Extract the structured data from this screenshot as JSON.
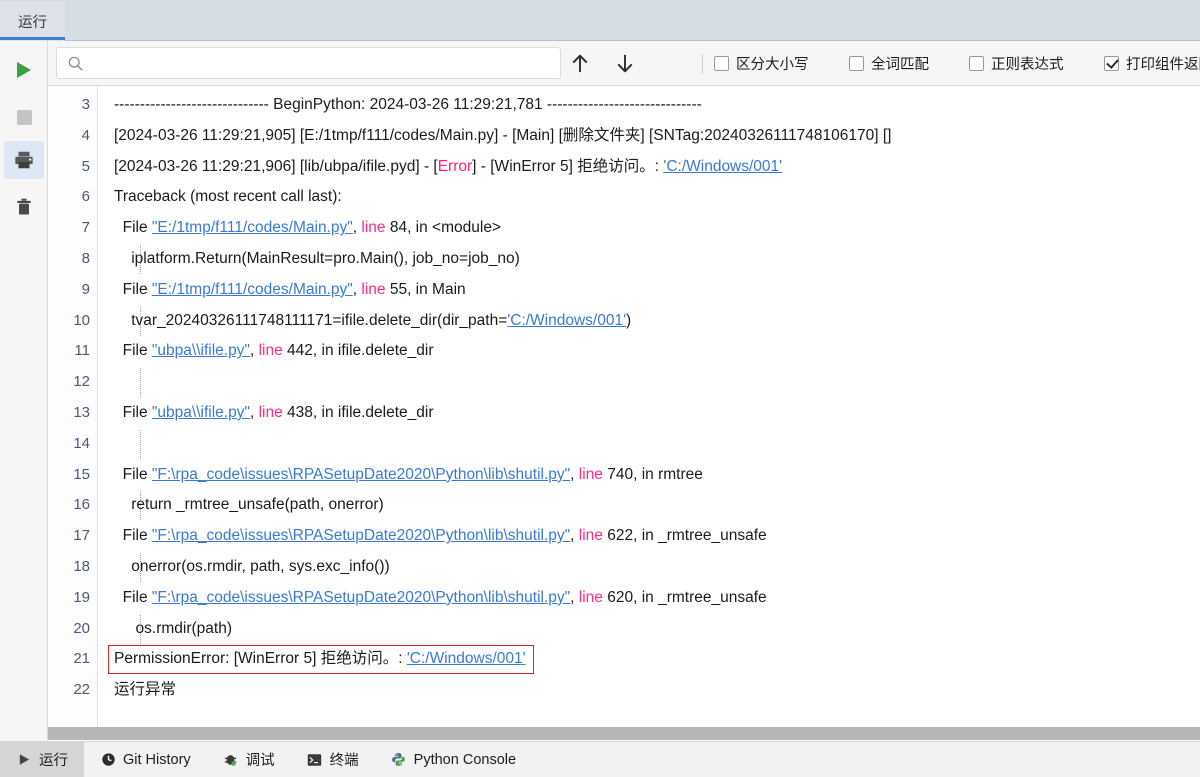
{
  "window": {
    "tab_label": "运行",
    "accent_color": "#3b7fd4"
  },
  "left_toolbar": {
    "buttons": [
      {
        "name": "run-button",
        "icon": "play-icon",
        "label": "运行",
        "active": false
      },
      {
        "name": "stop-button",
        "icon": "stop-icon",
        "label": "停止",
        "active": false
      },
      {
        "name": "print-button",
        "icon": "printer-icon",
        "label": "打印",
        "active": true
      },
      {
        "name": "clear-button",
        "icon": "trash-icon",
        "label": "清空",
        "active": false
      }
    ]
  },
  "findbar": {
    "search_value": "",
    "search_placeholder": "",
    "search_icon": "search-icon",
    "prev_icon": "arrow-up-icon",
    "next_icon": "arrow-down-icon",
    "options": [
      {
        "label": "区分大小写",
        "checked": false
      },
      {
        "label": "全词匹配",
        "checked": false
      },
      {
        "label": "正则表达式",
        "checked": false
      },
      {
        "label": "打印组件返回值",
        "checked": true
      }
    ]
  },
  "console": {
    "first_line_number": 3,
    "lines": [
      {
        "num": "3",
        "indent": false,
        "segments": [
          {
            "text": "------------------------------ BeginPython: 2024-03-26 11:29:21,781 ------------------------------",
            "style": "plain"
          }
        ]
      },
      {
        "num": "4",
        "indent": false,
        "segments": [
          {
            "text": "[2024-03-26 11:29:21,905] [E:/1tmp/f111/codes/Main.py] - [Main] [删除文件夹] [SNTag:20240326111748106170] []",
            "style": "plain"
          }
        ]
      },
      {
        "num": "5",
        "indent": false,
        "segments": [
          {
            "text": "[2024-03-26 11:29:21,906] [lib/ubpa/ifile.pyd] - [",
            "style": "plain"
          },
          {
            "text": "Error",
            "style": "error"
          },
          {
            "text": "] - [WinError 5] 拒绝访问。: ",
            "style": "plain"
          },
          {
            "text": "'C:/Windows/001'",
            "style": "link"
          }
        ]
      },
      {
        "num": "6",
        "indent": false,
        "segments": [
          {
            "text": "Traceback (most recent call last):",
            "style": "plain"
          }
        ]
      },
      {
        "num": "7",
        "indent": false,
        "segments": [
          {
            "text": "  File ",
            "style": "plain"
          },
          {
            "text": "\"E:/1tmp/f111/codes/Main.py\"",
            "style": "link"
          },
          {
            "text": ", ",
            "style": "plain"
          },
          {
            "text": "line",
            "style": "keyword"
          },
          {
            "text": " 84, in <module>",
            "style": "plain"
          }
        ]
      },
      {
        "num": "8",
        "indent": true,
        "segments": [
          {
            "text": "    iplatform.Return(MainResult=pro.Main(), job_no=job_no)",
            "style": "plain"
          }
        ]
      },
      {
        "num": "9",
        "indent": false,
        "segments": [
          {
            "text": "  File ",
            "style": "plain"
          },
          {
            "text": "\"E:/1tmp/f111/codes/Main.py\"",
            "style": "link"
          },
          {
            "text": ", ",
            "style": "plain"
          },
          {
            "text": "line",
            "style": "keyword"
          },
          {
            "text": " 55, in Main",
            "style": "plain"
          }
        ]
      },
      {
        "num": "10",
        "indent": true,
        "segments": [
          {
            "text": "    tvar_20240326111748111171=ifile.delete_dir(dir_path=",
            "style": "plain"
          },
          {
            "text": "'C:/Windows/001'",
            "style": "link"
          },
          {
            "text": ")",
            "style": "plain"
          }
        ]
      },
      {
        "num": "11",
        "indent": false,
        "segments": [
          {
            "text": "  File ",
            "style": "plain"
          },
          {
            "text": "\"ubpa\\\\ifile.py\"",
            "style": "link"
          },
          {
            "text": ", ",
            "style": "plain"
          },
          {
            "text": "line",
            "style": "keyword"
          },
          {
            "text": " 442, in ifile.delete_dir",
            "style": "plain"
          }
        ]
      },
      {
        "num": "12",
        "indent": true,
        "segments": []
      },
      {
        "num": "13",
        "indent": false,
        "segments": [
          {
            "text": "  File ",
            "style": "plain"
          },
          {
            "text": "\"ubpa\\\\ifile.py\"",
            "style": "link"
          },
          {
            "text": ", ",
            "style": "plain"
          },
          {
            "text": "line",
            "style": "keyword"
          },
          {
            "text": " 438, in ifile.delete_dir",
            "style": "plain"
          }
        ]
      },
      {
        "num": "14",
        "indent": true,
        "segments": []
      },
      {
        "num": "15",
        "indent": false,
        "segments": [
          {
            "text": "  File ",
            "style": "plain"
          },
          {
            "text": "\"F:\\rpa_code\\issues\\RPASetupDate2020\\Python\\lib\\shutil.py\"",
            "style": "link"
          },
          {
            "text": ", ",
            "style": "plain"
          },
          {
            "text": "line",
            "style": "keyword"
          },
          {
            "text": " 740, in rmtree",
            "style": "plain"
          }
        ]
      },
      {
        "num": "16",
        "indent": true,
        "segments": [
          {
            "text": "    return _rmtree_unsafe(path, onerror)",
            "style": "plain"
          }
        ]
      },
      {
        "num": "17",
        "indent": false,
        "segments": [
          {
            "text": "  File ",
            "style": "plain"
          },
          {
            "text": "\"F:\\rpa_code\\issues\\RPASetupDate2020\\Python\\lib\\shutil.py\"",
            "style": "link"
          },
          {
            "text": ", ",
            "style": "plain"
          },
          {
            "text": "line",
            "style": "keyword"
          },
          {
            "text": " 622, in _rmtree_unsafe",
            "style": "plain"
          }
        ]
      },
      {
        "num": "18",
        "indent": true,
        "segments": [
          {
            "text": "    onerror(os.rmdir, path, sys.exc_info())",
            "style": "plain"
          }
        ]
      },
      {
        "num": "19",
        "indent": false,
        "segments": [
          {
            "text": "  File ",
            "style": "plain"
          },
          {
            "text": "\"F:\\rpa_code\\issues\\RPASetupDate2020\\Python\\lib\\shutil.py\"",
            "style": "link"
          },
          {
            "text": ", ",
            "style": "plain"
          },
          {
            "text": "line",
            "style": "keyword"
          },
          {
            "text": " 620, in _rmtree_unsafe",
            "style": "plain"
          }
        ]
      },
      {
        "num": "20",
        "indent": true,
        "segments": [
          {
            "text": "     os.rmdir(path)",
            "style": "plain"
          }
        ]
      },
      {
        "num": "21",
        "indent": false,
        "boxed": true,
        "box_color": "#e02020",
        "segments": [
          {
            "text": "PermissionError: [WinError 5] 拒绝访问。: ",
            "style": "plain"
          },
          {
            "text": "'C:/Windows/001'",
            "style": "link"
          }
        ]
      },
      {
        "num": "22",
        "indent": false,
        "segments": [
          {
            "text": "运行异常",
            "style": "plain"
          }
        ]
      }
    ]
  },
  "bottom_tabs": [
    {
      "label": "运行",
      "icon": "play-icon",
      "active": true
    },
    {
      "label": "Git History",
      "icon": "clock-icon",
      "active": false
    },
    {
      "label": "调试",
      "icon": "bug-icon",
      "active": false
    },
    {
      "label": "终端",
      "icon": "terminal-icon",
      "active": false
    },
    {
      "label": "Python Console",
      "icon": "python-icon",
      "active": false
    }
  ]
}
